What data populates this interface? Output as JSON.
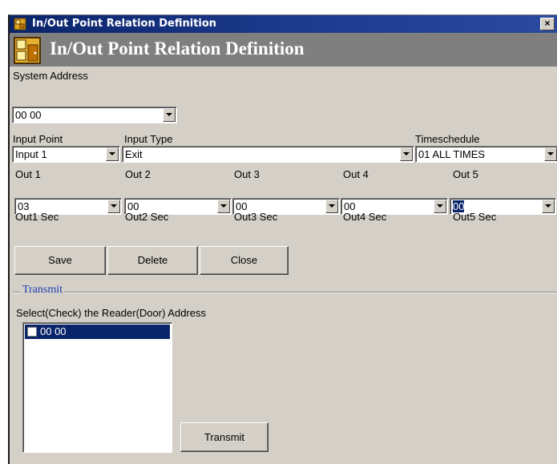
{
  "window": {
    "title": "In/Out Point Relation Definition",
    "close_glyph": "×"
  },
  "banner": {
    "title": "In/Out Point Relation Definition"
  },
  "system_address": {
    "label": "System Address",
    "value": "00 00"
  },
  "input_point": {
    "label": "Input Point",
    "value": "Input 1"
  },
  "input_type": {
    "label": "Input Type",
    "value": "Exit"
  },
  "timeschedule": {
    "label": "Timeschedule",
    "value": "01 ALL TIMES"
  },
  "outs": [
    {
      "label": "Out 1",
      "value": "03",
      "sec_label": "Out1 Sec"
    },
    {
      "label": "Out 2",
      "value": "00",
      "sec_label": "Out2 Sec"
    },
    {
      "label": "Out 3",
      "value": "00",
      "sec_label": "Out3 Sec"
    },
    {
      "label": "Out 4",
      "value": "00",
      "sec_label": "Out4 Sec"
    },
    {
      "label": "Out 5",
      "value": "00",
      "sec_label": "Out5 Sec"
    }
  ],
  "buttons": {
    "save": "Save",
    "delete": "Delete",
    "close": "Close"
  },
  "transmit": {
    "group_label": "Transmit",
    "instruction": "Select(Check) the Reader(Door) Address",
    "items": [
      {
        "label": "00 00",
        "checked": false
      }
    ],
    "button": "Transmit"
  },
  "colors": {
    "titlebar": "#0a246a",
    "banner": "#7f7f7f",
    "dialog_bg": "#d4d0c8",
    "selection": "#0a246a",
    "group_label": "#1f3db0"
  }
}
